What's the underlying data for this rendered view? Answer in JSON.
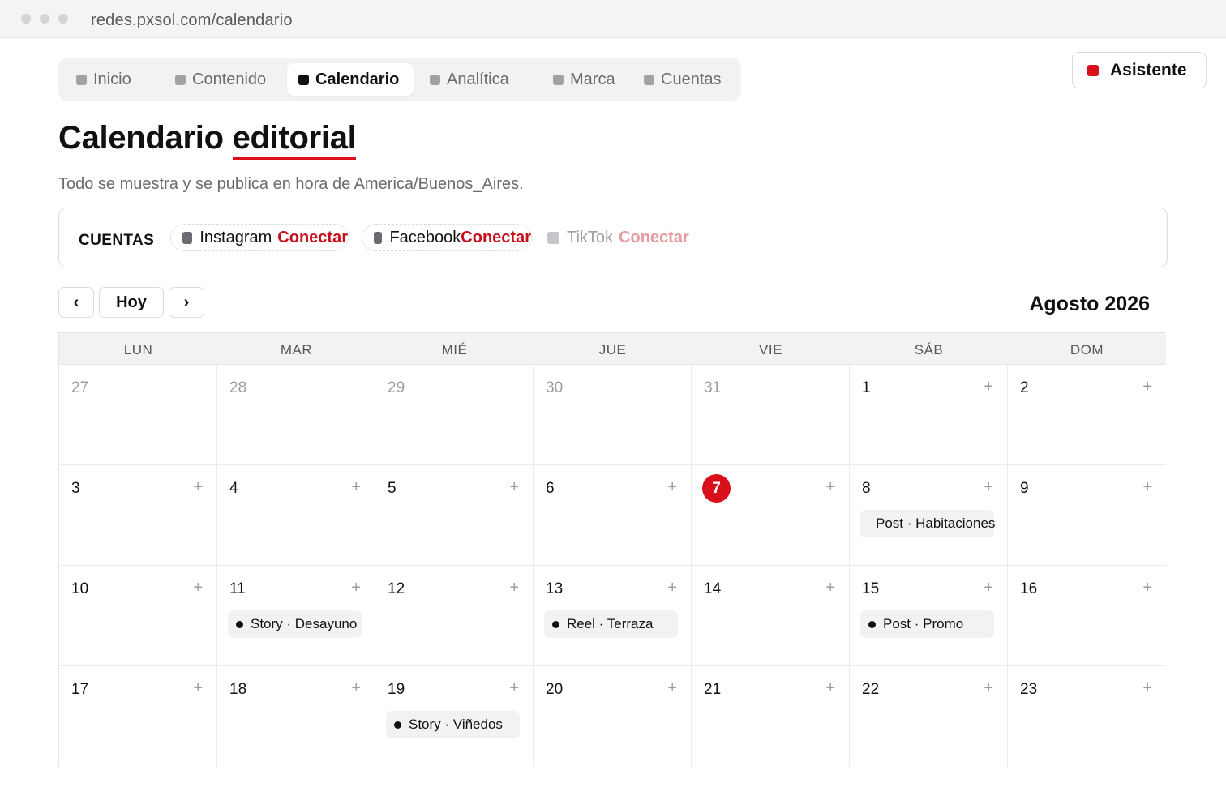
{
  "browser": {
    "url": "redes.pxsol.com/calendario"
  },
  "tabs": [
    {
      "label": "Inicio"
    },
    {
      "label": "Contenido"
    },
    {
      "label": "Calendario"
    },
    {
      "label": "Analítica"
    },
    {
      "label": "Marca"
    },
    {
      "label": "Cuentas"
    }
  ],
  "assistant": {
    "label": "Asistente"
  },
  "page": {
    "title_part1": "Calendario",
    "title_part2": "editorial",
    "subtitle": "Todo se muestra y se publica en hora de America/Buenos_Aires."
  },
  "accounts": {
    "label": "CUENTAS",
    "items": [
      {
        "name": "Instagram",
        "action": "Conectar"
      },
      {
        "name": "Facebook",
        "action": "Conectar"
      },
      {
        "name": "TikTok",
        "action": "Conectar"
      }
    ]
  },
  "nav": {
    "prev": "‹",
    "today": "Hoy",
    "next": "›",
    "month": "Agosto 2026"
  },
  "calendar": {
    "weekdays": [
      "LUN",
      "MAR",
      "MIÉ",
      "JUE",
      "VIE",
      "SÁB",
      "DOM"
    ],
    "plus": "+",
    "days": [
      "27",
      "28",
      "29",
      "30",
      "31",
      "1",
      "2",
      "3",
      "4",
      "5",
      "6",
      "7",
      "8",
      "9",
      "10",
      "11",
      "12",
      "13",
      "14",
      "15",
      "16",
      "17",
      "18",
      "19",
      "20",
      "21",
      "22",
      "23"
    ],
    "events": {
      "d8": "Post · Habitaciones",
      "d11": "Story · Desayuno",
      "d13": "Reel · Terraza",
      "d15": "Post · Promo",
      "d19": "Story · Viñedos"
    }
  },
  "colors": {
    "accent": "#d90f1c",
    "connect": "#c8101c"
  }
}
